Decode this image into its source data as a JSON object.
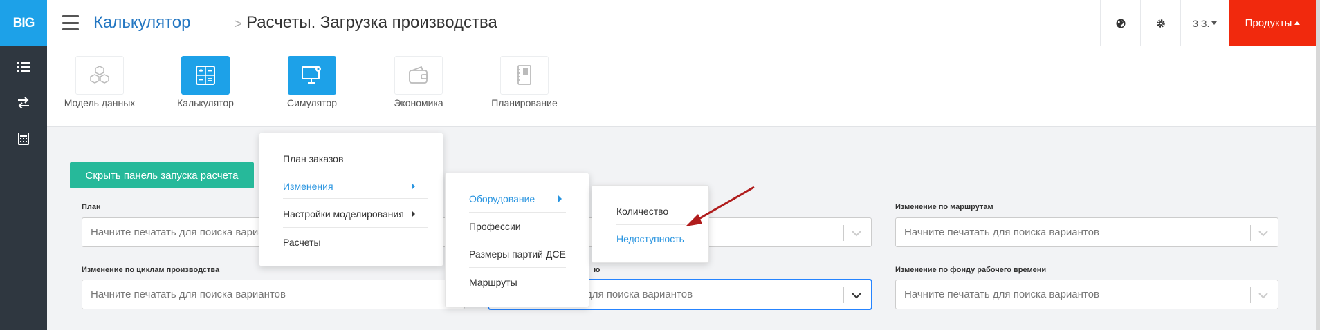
{
  "logo_text": "BIG",
  "sidebar_icons": [
    "list-icon",
    "swap-icon",
    "calculator-icon"
  ],
  "breadcrumb": {
    "parent": "Калькулятор",
    "separator": ">",
    "current": "Расчеты. Загрузка производства"
  },
  "topbar": {
    "user": "З З.",
    "products": "Продукты"
  },
  "modules": [
    {
      "label": "Модель данных",
      "active": false
    },
    {
      "label": "Калькулятор",
      "active": true
    },
    {
      "label": "Симулятор",
      "active": true
    },
    {
      "label": "Экономика",
      "active": false
    },
    {
      "label": "Планирование",
      "active": false
    }
  ],
  "hide_button": "Скрыть панель запуска расчета",
  "fields": {
    "plan_label": "План",
    "route_change_label": "Изменение по маршрутам",
    "cycle_change_label": "Изменение по циклам производства",
    "partial_label": "ю",
    "fund_change_label": "Изменение по фонду рабочего времени",
    "placeholder": "Начните печатать для поиска вариантов",
    "placeholder_tail": "для поиска вариантов"
  },
  "menu1": {
    "items": [
      "План заказов",
      "Изменения",
      "Настройки моделирования",
      "Расчеты"
    ]
  },
  "menu2": {
    "items": [
      "Оборудование",
      "Профессии",
      "Размеры партий ДСЕ",
      "Маршруты"
    ]
  },
  "menu3": {
    "items": [
      "Количество",
      "Недоступность"
    ]
  },
  "colors": {
    "accent": "#1da1e8",
    "products": "#f1290d",
    "hide_button": "#26b99a",
    "active_menu": "#2a95e0",
    "arrow": "#b01c1c"
  }
}
